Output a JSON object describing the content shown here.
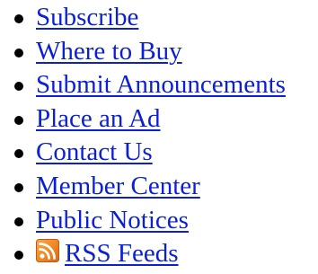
{
  "nav": {
    "items": [
      {
        "label": "Subscribe"
      },
      {
        "label": "Where to Buy"
      },
      {
        "label": "Submit Announcements"
      },
      {
        "label": "Place an Ad"
      },
      {
        "label": "Contact Us"
      },
      {
        "label": "Member Center"
      },
      {
        "label": "Public Notices"
      },
      {
        "label": "RSS Feeds",
        "icon": "rss-icon"
      }
    ],
    "colors": {
      "link": "#0a1fd6",
      "rss_icon": "#f08a24"
    }
  }
}
